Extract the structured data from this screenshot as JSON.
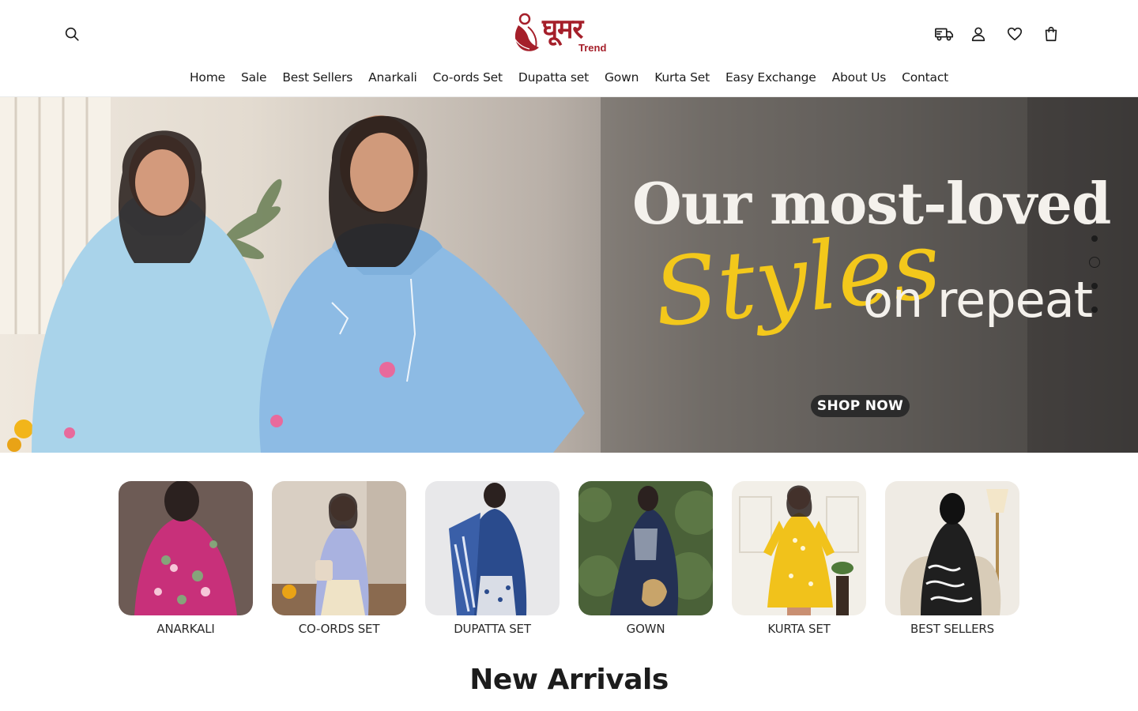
{
  "brand": {
    "logo_text": "घूमर",
    "logo_sub": "Trend"
  },
  "header": {
    "icons": [
      "search-icon",
      "delivery-truck-icon",
      "account-icon",
      "heart-icon",
      "shopping-bag-icon"
    ]
  },
  "nav": {
    "items": [
      {
        "label": "Home"
      },
      {
        "label": "Sale"
      },
      {
        "label": "Best Sellers"
      },
      {
        "label": "Anarkali"
      },
      {
        "label": "Co-ords Set"
      },
      {
        "label": "Dupatta set"
      },
      {
        "label": "Gown"
      },
      {
        "label": "Kurta Set"
      },
      {
        "label": "Easy Exchange"
      },
      {
        "label": "About Us"
      },
      {
        "label": "Contact"
      }
    ]
  },
  "hero": {
    "title": "Our most-loved",
    "script": "Styles",
    "subtitle": "on repeat",
    "cta": "SHOP NOW",
    "slides_count": 4,
    "active_slide": 2
  },
  "categories": [
    {
      "label": "ANARKALI",
      "color": "#c8307a"
    },
    {
      "label": "CO-ORDS SET",
      "color": "#a9b2e0"
    },
    {
      "label": "DUPATTA SET",
      "color": "#2a4b8d"
    },
    {
      "label": "GOWN",
      "color": "#243154"
    },
    {
      "label": "KURTA SET",
      "color": "#f1c21b"
    },
    {
      "label": "BEST SELLERS",
      "color": "#1f1f1f"
    }
  ],
  "sections": {
    "new_arrivals_title": "New Arrivals"
  },
  "colors": {
    "brand": "#a51f2a",
    "accent_yellow": "#f3c81b",
    "text": "#1c1c1c"
  }
}
